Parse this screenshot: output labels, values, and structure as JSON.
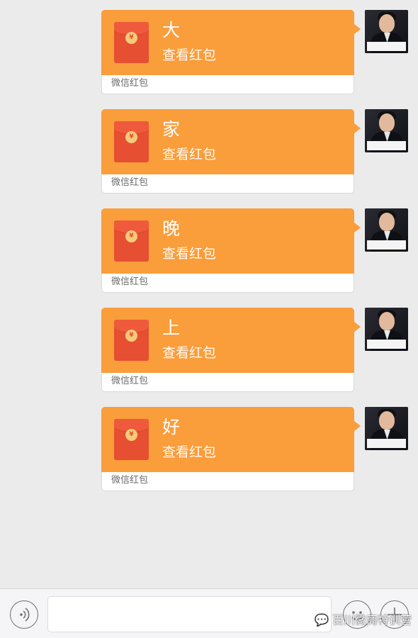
{
  "theme": {
    "background": "#ebebeb",
    "red_packet_orange": "#fa9d3b",
    "envelope_red": "#e64f32",
    "seal_gold": "#f5cb7a"
  },
  "messages": [
    {
      "char": "大",
      "action": "查看红包",
      "footer": "微信红包"
    },
    {
      "char": "家",
      "action": "查看红包",
      "footer": "微信红包"
    },
    {
      "char": "晚",
      "action": "查看红包",
      "footer": "微信红包"
    },
    {
      "char": "上",
      "action": "查看红包",
      "footer": "微信红包"
    },
    {
      "char": "好",
      "action": "查看红包",
      "footer": "微信红包"
    }
  ],
  "envelope": {
    "seal_symbol": "¥"
  },
  "avatar": {
    "icon": "user-avatar-photo"
  },
  "input_bar": {
    "voice_icon": "voice-icon",
    "emoji_icon": "emoji-icon",
    "plus_icon": "plus-icon",
    "text_value": "",
    "watermark": "百川微商特训营"
  }
}
